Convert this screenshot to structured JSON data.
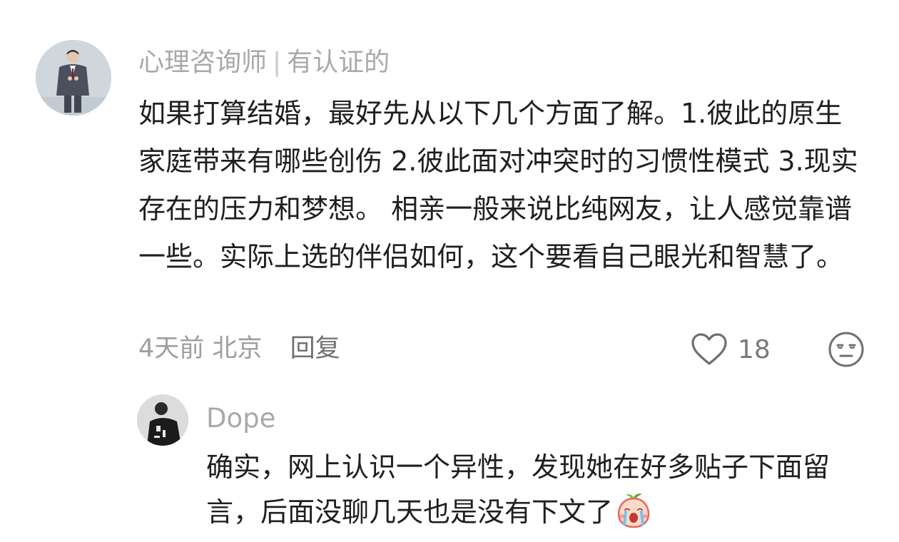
{
  "comment": {
    "author_name": "心理咨询师",
    "author_badge": "有认证的",
    "text": "如果打算结婚，最好先从以下几个方面了解。1.彼此的原生家庭带来有哪些创伤 2.彼此面对冲突时的习惯性模式 3.现实存在的压力和梦想。 相亲一般来说比纯网友，让人感觉靠谱一些。实际上选的伴侣如何，这个要看自己眼光和智慧了。",
    "time": "4天前",
    "location": "北京",
    "reply_label": "回复",
    "like_count": "18"
  },
  "reply": {
    "author_name": "Dope",
    "text": "确实，网上认识一个异性，发现她在好多贴子下面留言，后面没聊几天也是没有下文了"
  },
  "icons": {
    "like": "heart-outline-icon",
    "dislike": "unamused-face-icon",
    "reply_emoji": "crying-peach-emoji-icon"
  },
  "colors": {
    "text_primary": "#1f1f1f",
    "text_secondary": "#a9a9a9",
    "meta": "#9e9e9e",
    "background": "#ffffff"
  }
}
